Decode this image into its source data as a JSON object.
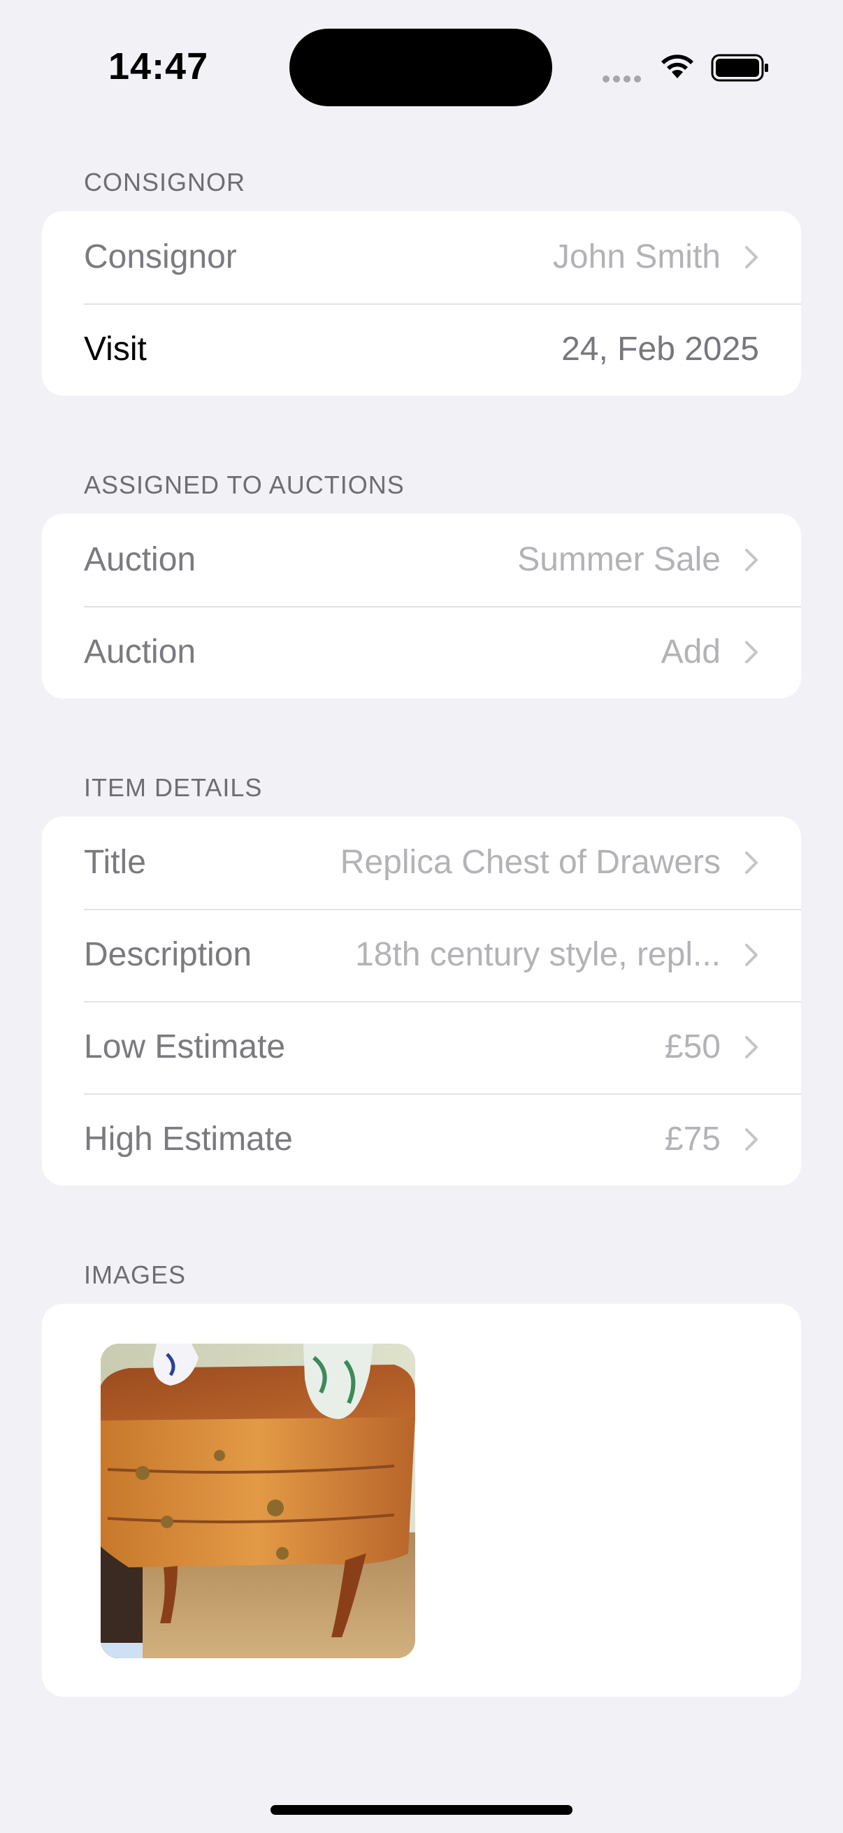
{
  "status": {
    "time": "14:47"
  },
  "sections": {
    "consignor": {
      "header": "CONSIGNOR",
      "rows": [
        {
          "label": "Consignor",
          "value": "John Smith"
        },
        {
          "label": "Visit",
          "value": "24, Feb 2025"
        }
      ]
    },
    "auctions": {
      "header": "ASSIGNED TO AUCTIONS",
      "rows": [
        {
          "label": "Auction",
          "value": "Summer Sale"
        },
        {
          "label": "Auction",
          "value": "Add"
        }
      ]
    },
    "item": {
      "header": "ITEM DETAILS",
      "rows": [
        {
          "label": "Title",
          "value": "Replica Chest of Drawers"
        },
        {
          "label": "Description",
          "value": "18th century style, repl..."
        },
        {
          "label": "Low Estimate",
          "value": "£50"
        },
        {
          "label": "High Estimate",
          "value": "£75"
        }
      ]
    },
    "images": {
      "header": "IMAGES",
      "photos": [
        {
          "subject": "chest-of-drawers"
        }
      ]
    }
  },
  "colors": {
    "background": "#f2f1f6",
    "card": "#ffffff",
    "secondary_text": "#b3b3b7",
    "label_text": "#7a7a7f"
  }
}
